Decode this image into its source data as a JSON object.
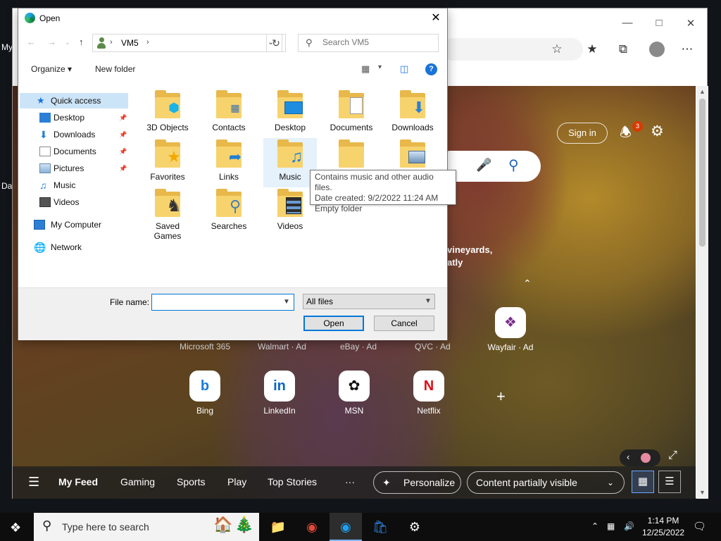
{
  "dialog": {
    "title": "Open",
    "breadcrumb": {
      "location": "VM5"
    },
    "search_placeholder": "Search VM5",
    "toolbar": {
      "organize": "Organize",
      "new_folder": "New folder"
    },
    "nav": {
      "quick_access": "Quick access",
      "items": [
        {
          "label": "Desktop",
          "pinned": true
        },
        {
          "label": "Downloads",
          "pinned": true
        },
        {
          "label": "Documents",
          "pinned": true
        },
        {
          "label": "Pictures",
          "pinned": true
        },
        {
          "label": "Music",
          "pinned": false
        },
        {
          "label": "Videos",
          "pinned": false
        }
      ],
      "my_computer": "My Computer",
      "network": "Network"
    },
    "folders": [
      {
        "name": "3D Objects",
        "icon": "cube-icon"
      },
      {
        "name": "Contacts",
        "icon": "contact-card-icon"
      },
      {
        "name": "Desktop",
        "icon": "monitor-icon"
      },
      {
        "name": "Documents",
        "icon": "document-icon"
      },
      {
        "name": "Downloads",
        "icon": "download-arrow-icon"
      },
      {
        "name": "Favorites",
        "icon": "star-icon"
      },
      {
        "name": "Links",
        "icon": "link-arrow-icon"
      },
      {
        "name": "Music",
        "icon": "music-note-icon"
      },
      {
        "name": "",
        "icon": "folder-icon"
      },
      {
        "name": "",
        "icon": "picture-icon"
      },
      {
        "name": "Saved Games",
        "icon": "chess-piece-icon"
      },
      {
        "name": "Searches",
        "icon": "magnifier-icon"
      },
      {
        "name": "Videos",
        "icon": "film-icon"
      }
    ],
    "tooltip": {
      "line1": "Contains music and other audio files.",
      "line2": "Date created: 9/2/2022 11:24 AM",
      "line3": "Empty folder"
    },
    "filename_label": "File name:",
    "filename_value": "",
    "filetype": "All files",
    "open_label": "Open",
    "cancel_label": "Cancel"
  },
  "browser": {
    "sign_in": "Sign in",
    "notification_count": "3",
    "caption_line1": "vineyards,",
    "caption_line2": "atly",
    "partial_tile_labels": [
      "Microsoft 365",
      "Walmart · Ad",
      "eBay · Ad",
      "QVC · Ad"
    ],
    "quick_links": [
      {
        "label": "Wayfair · Ad",
        "icon": "wayfair-icon",
        "color": "#7b2e8e"
      },
      {
        "label": "Bing",
        "icon": "bing-icon",
        "color": "#1a7bd8"
      },
      {
        "label": "LinkedIn",
        "icon": "linkedin-icon",
        "color": "#0a66c2"
      },
      {
        "label": "MSN",
        "icon": "msn-icon",
        "color": "#111111"
      },
      {
        "label": "Netflix",
        "icon": "netflix-icon",
        "color": "#e50914"
      }
    ],
    "feed_tabs": [
      "My Feed",
      "Gaming",
      "Sports",
      "Play",
      "Top Stories"
    ],
    "more": "···",
    "personalize": "Personalize",
    "content_visibility": "Content partially visible"
  },
  "desktop": {
    "fragments": [
      "My",
      "Da"
    ]
  },
  "taskbar": {
    "search_placeholder": "Type here to search",
    "time": "1:14 PM",
    "date": "12/25/2022"
  }
}
